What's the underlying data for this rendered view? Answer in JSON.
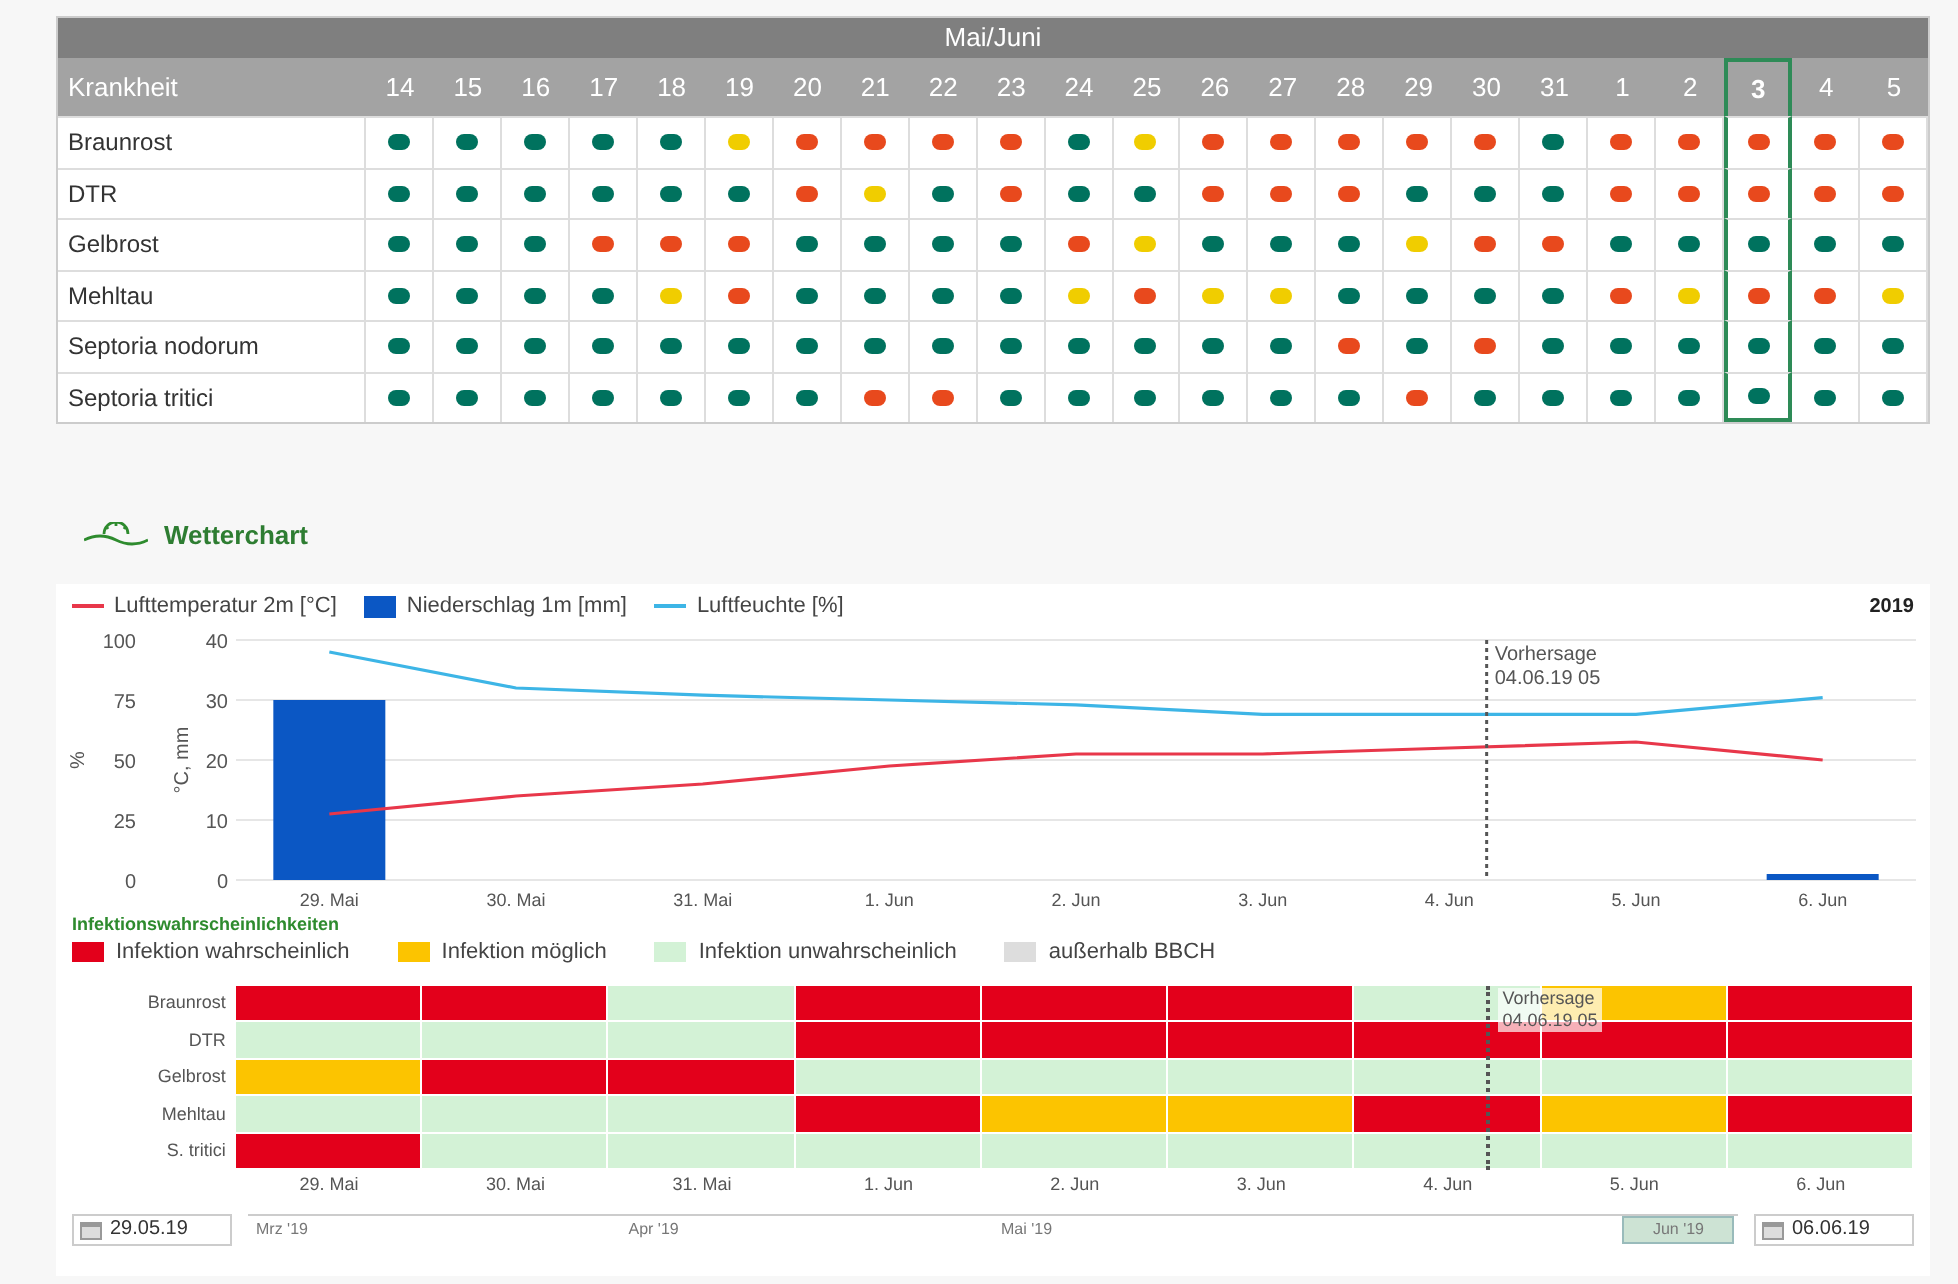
{
  "disease_table": {
    "month_header": "Mai/Juni",
    "label_header": "Krankheit",
    "days": [
      {
        "label": "14",
        "selected": false
      },
      {
        "label": "15",
        "selected": false
      },
      {
        "label": "16",
        "selected": false
      },
      {
        "label": "17",
        "selected": false
      },
      {
        "label": "18",
        "selected": false
      },
      {
        "label": "19",
        "selected": false
      },
      {
        "label": "20",
        "selected": false
      },
      {
        "label": "21",
        "selected": false
      },
      {
        "label": "22",
        "selected": false
      },
      {
        "label": "23",
        "selected": false
      },
      {
        "label": "24",
        "selected": false
      },
      {
        "label": "25",
        "selected": false
      },
      {
        "label": "26",
        "selected": false
      },
      {
        "label": "27",
        "selected": false
      },
      {
        "label": "28",
        "selected": false
      },
      {
        "label": "29",
        "selected": false
      },
      {
        "label": "30",
        "selected": false
      },
      {
        "label": "31",
        "selected": false
      },
      {
        "label": "1",
        "selected": false
      },
      {
        "label": "2",
        "selected": false
      },
      {
        "label": "3",
        "selected": true
      },
      {
        "label": "4",
        "selected": false
      },
      {
        "label": "5",
        "selected": false
      }
    ],
    "rows": [
      {
        "name": "Braunrost",
        "cells": [
          {
            "color": "#00725e"
          },
          {
            "color": "#00725e"
          },
          {
            "color": "#00725e"
          },
          {
            "color": "#00725e"
          },
          {
            "color": "#00725e"
          },
          {
            "color": "#f0cd00"
          },
          {
            "color": "#e8491d"
          },
          {
            "color": "#e8491d"
          },
          {
            "color": "#e8491d"
          },
          {
            "color": "#e8491d"
          },
          {
            "color": "#00725e"
          },
          {
            "color": "#f0cd00"
          },
          {
            "color": "#e8491d"
          },
          {
            "color": "#e8491d"
          },
          {
            "color": "#e8491d"
          },
          {
            "color": "#e8491d"
          },
          {
            "color": "#e8491d"
          },
          {
            "color": "#00725e"
          },
          {
            "color": "#e8491d"
          },
          {
            "color": "#e8491d"
          },
          {
            "color": "#e8491d"
          },
          {
            "color": "#e8491d"
          },
          {
            "color": "#e8491d"
          }
        ]
      },
      {
        "name": "DTR",
        "cells": [
          {
            "color": "#00725e"
          },
          {
            "color": "#00725e"
          },
          {
            "color": "#00725e"
          },
          {
            "color": "#00725e"
          },
          {
            "color": "#00725e"
          },
          {
            "color": "#00725e"
          },
          {
            "color": "#e8491d"
          },
          {
            "color": "#f0cd00"
          },
          {
            "color": "#00725e"
          },
          {
            "color": "#e8491d"
          },
          {
            "color": "#00725e"
          },
          {
            "color": "#00725e"
          },
          {
            "color": "#e8491d"
          },
          {
            "color": "#e8491d"
          },
          {
            "color": "#e8491d"
          },
          {
            "color": "#00725e"
          },
          {
            "color": "#00725e"
          },
          {
            "color": "#00725e"
          },
          {
            "color": "#e8491d"
          },
          {
            "color": "#e8491d"
          },
          {
            "color": "#e8491d"
          },
          {
            "color": "#e8491d"
          },
          {
            "color": "#e8491d"
          }
        ]
      },
      {
        "name": "Gelbrost",
        "cells": [
          {
            "color": "#00725e"
          },
          {
            "color": "#00725e"
          },
          {
            "color": "#00725e"
          },
          {
            "color": "#e8491d"
          },
          {
            "color": "#e8491d"
          },
          {
            "color": "#e8491d"
          },
          {
            "color": "#00725e"
          },
          {
            "color": "#00725e"
          },
          {
            "color": "#00725e"
          },
          {
            "color": "#00725e"
          },
          {
            "color": "#e8491d"
          },
          {
            "color": "#f0cd00"
          },
          {
            "color": "#00725e"
          },
          {
            "color": "#00725e"
          },
          {
            "color": "#00725e"
          },
          {
            "color": "#f0cd00"
          },
          {
            "color": "#e8491d"
          },
          {
            "color": "#e8491d"
          },
          {
            "color": "#00725e"
          },
          {
            "color": "#00725e"
          },
          {
            "color": "#00725e"
          },
          {
            "color": "#00725e"
          },
          {
            "color": "#00725e"
          }
        ]
      },
      {
        "name": "Mehltau",
        "cells": [
          {
            "color": "#00725e"
          },
          {
            "color": "#00725e"
          },
          {
            "color": "#00725e"
          },
          {
            "color": "#00725e"
          },
          {
            "color": "#f0cd00"
          },
          {
            "color": "#e8491d"
          },
          {
            "color": "#00725e"
          },
          {
            "color": "#00725e"
          },
          {
            "color": "#00725e"
          },
          {
            "color": "#00725e"
          },
          {
            "color": "#f0cd00"
          },
          {
            "color": "#e8491d"
          },
          {
            "color": "#f0cd00"
          },
          {
            "color": "#f0cd00"
          },
          {
            "color": "#00725e"
          },
          {
            "color": "#00725e"
          },
          {
            "color": "#00725e"
          },
          {
            "color": "#00725e"
          },
          {
            "color": "#e8491d"
          },
          {
            "color": "#f0cd00"
          },
          {
            "color": "#e8491d"
          },
          {
            "color": "#e8491d"
          },
          {
            "color": "#f0cd00"
          }
        ]
      },
      {
        "name": "Septoria nodorum",
        "cells": [
          {
            "color": "#00725e"
          },
          {
            "color": "#00725e"
          },
          {
            "color": "#00725e"
          },
          {
            "color": "#00725e"
          },
          {
            "color": "#00725e"
          },
          {
            "color": "#00725e"
          },
          {
            "color": "#00725e"
          },
          {
            "color": "#00725e"
          },
          {
            "color": "#00725e"
          },
          {
            "color": "#00725e"
          },
          {
            "color": "#00725e"
          },
          {
            "color": "#00725e"
          },
          {
            "color": "#00725e"
          },
          {
            "color": "#00725e"
          },
          {
            "color": "#e8491d"
          },
          {
            "color": "#00725e"
          },
          {
            "color": "#e8491d"
          },
          {
            "color": "#00725e"
          },
          {
            "color": "#00725e"
          },
          {
            "color": "#00725e"
          },
          {
            "color": "#00725e"
          },
          {
            "color": "#00725e"
          },
          {
            "color": "#00725e"
          }
        ]
      },
      {
        "name": "Septoria tritici",
        "cells": [
          {
            "color": "#00725e"
          },
          {
            "color": "#00725e"
          },
          {
            "color": "#00725e"
          },
          {
            "color": "#00725e"
          },
          {
            "color": "#00725e"
          },
          {
            "color": "#00725e"
          },
          {
            "color": "#00725e"
          },
          {
            "color": "#e8491d"
          },
          {
            "color": "#e8491d"
          },
          {
            "color": "#00725e"
          },
          {
            "color": "#00725e"
          },
          {
            "color": "#00725e"
          },
          {
            "color": "#00725e"
          },
          {
            "color": "#00725e"
          },
          {
            "color": "#00725e"
          },
          {
            "color": "#e8491d"
          },
          {
            "color": "#00725e"
          },
          {
            "color": "#00725e"
          },
          {
            "color": "#00725e"
          },
          {
            "color": "#00725e"
          },
          {
            "color": "#00725e"
          },
          {
            "color": "#00725e"
          },
          {
            "color": "#00725e"
          }
        ]
      }
    ]
  },
  "weather_section": {
    "title": "Wetterchart"
  },
  "weather_chart": {
    "year": "2019",
    "chart_data": {
      "type": "line",
      "categories": [
        "29. Mai",
        "30. Mai",
        "31. Mai",
        "1. Jun",
        "2. Jun",
        "3. Jun",
        "4. Jun",
        "5. Jun",
        "6. Jun"
      ],
      "ylabel": "°C, mm",
      "ylim": [
        0,
        40
      ],
      "yticks": [
        0,
        10,
        20,
        30,
        40
      ],
      "y2label": "%",
      "y2lim": [
        0,
        100
      ],
      "y2ticks": [
        0,
        25,
        50,
        75,
        100
      ],
      "grid": true,
      "series": [
        {
          "name": "Lufttemperatur 2m [°C]",
          "color": "#e8374a",
          "values": [
            11,
            14,
            16,
            19,
            21,
            21,
            22,
            23,
            20
          ]
        },
        {
          "name": "Niederschlag 1m [mm]",
          "color": "#0b57c4",
          "type": "bar",
          "values": [
            30,
            null,
            null,
            null,
            null,
            null,
            null,
            null,
            1
          ]
        },
        {
          "name": "Luftfeuchte [%]",
          "color": "#3db5e6",
          "axis": "y2",
          "values": [
            95,
            80,
            77,
            75,
            73,
            69,
            69,
            69,
            76
          ]
        }
      ],
      "ref_lines": [
        {
          "axis": "x",
          "value": "4. Jun",
          "label": "Vorhersage 04.06.19 05"
        }
      ]
    }
  },
  "infection_chart": {
    "title": "Infektionswahrscheinlichkeiten",
    "legend": [
      {
        "label": "Infektion wahrscheinlich",
        "color": "#e3001b"
      },
      {
        "label": "Infektion möglich",
        "color": "#fcc400"
      },
      {
        "label": "Infektion unwahrscheinlich",
        "color": "#d3f2d6"
      },
      {
        "label": "außerhalb BBCH",
        "color": "#dddddd"
      }
    ],
    "rows": [
      {
        "name": "Braunrost",
        "cells": [
          {
            "color": "#e3001b"
          },
          {
            "color": "#e3001b"
          },
          {
            "color": "#d3f2d6"
          },
          {
            "color": "#e3001b"
          },
          {
            "color": "#e3001b"
          },
          {
            "color": "#e3001b"
          },
          {
            "color": "#d3f2d6"
          },
          {
            "color": "#fcc400"
          },
          {
            "color": "#e3001b"
          }
        ]
      },
      {
        "name": "DTR",
        "cells": [
          {
            "color": "#d3f2d6"
          },
          {
            "color": "#d3f2d6"
          },
          {
            "color": "#d3f2d6"
          },
          {
            "color": "#e3001b"
          },
          {
            "color": "#e3001b"
          },
          {
            "color": "#e3001b"
          },
          {
            "color": "#e3001b"
          },
          {
            "color": "#e3001b"
          },
          {
            "color": "#e3001b"
          }
        ]
      },
      {
        "name": "Gelbrost",
        "cells": [
          {
            "color": "#fcc400"
          },
          {
            "color": "#e3001b"
          },
          {
            "color": "#e3001b"
          },
          {
            "color": "#d3f2d6"
          },
          {
            "color": "#d3f2d6"
          },
          {
            "color": "#d3f2d6"
          },
          {
            "color": "#d3f2d6"
          },
          {
            "color": "#d3f2d6"
          },
          {
            "color": "#d3f2d6"
          }
        ]
      },
      {
        "name": "Mehltau",
        "cells": [
          {
            "color": "#d3f2d6"
          },
          {
            "color": "#d3f2d6"
          },
          {
            "color": "#d3f2d6"
          },
          {
            "color": "#e3001b"
          },
          {
            "color": "#fcc400"
          },
          {
            "color": "#fcc400"
          },
          {
            "color": "#e3001b"
          },
          {
            "color": "#fcc400"
          },
          {
            "color": "#e3001b"
          }
        ]
      },
      {
        "name": "S. tritici",
        "cells": [
          {
            "color": "#e3001b"
          },
          {
            "color": "#d3f2d6"
          },
          {
            "color": "#d3f2d6"
          },
          {
            "color": "#d3f2d6"
          },
          {
            "color": "#d3f2d6"
          },
          {
            "color": "#d3f2d6"
          },
          {
            "color": "#d3f2d6"
          },
          {
            "color": "#d3f2d6"
          },
          {
            "color": "#d3f2d6"
          }
        ]
      }
    ],
    "categories": [
      "29. Mai",
      "30. Mai",
      "31. Mai",
      "1. Jun",
      "2. Jun",
      "3. Jun",
      "4. Jun",
      "5. Jun",
      "6. Jun"
    ],
    "forecast": {
      "label": "Vorhersage",
      "sublabel": "04.06.19 05"
    }
  },
  "navigator": {
    "start_date": "29.05.19",
    "months": [
      {
        "label": "Mrz '19",
        "selected": false
      },
      {
        "label": "Apr '19",
        "selected": false
      },
      {
        "label": "Mai '19",
        "selected": false
      },
      {
        "label": "Jun '19",
        "selected": true
      }
    ],
    "end_date": "06.06.19"
  }
}
